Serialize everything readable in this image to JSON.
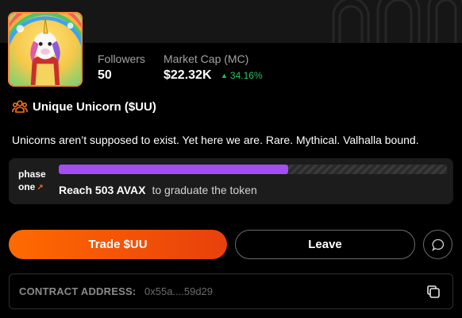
{
  "stats": {
    "followers_label": "Followers",
    "followers_value": "50",
    "market_cap_label": "Market Cap (MC)",
    "market_cap_value": "$22.32K",
    "market_cap_change": "34.16%",
    "change_icon": "triangle-up-icon"
  },
  "token": {
    "name": "Unique Unicorn ($UU)",
    "icon": "users-group-icon",
    "description": "Unicorns aren’t supposed to exist. Yet here we are. Rare. Mythical. Valhalla bound."
  },
  "phase": {
    "label_line1": "phase",
    "label_line2": "one",
    "external_icon": "↗",
    "progress": 0.59,
    "goal_amount": "Reach 503 AVAX",
    "goal_text": "to graduate the token"
  },
  "actions": {
    "trade_label": "Trade $UU",
    "leave_label": "Leave",
    "chat_icon": "chat-bubble-icon"
  },
  "contract": {
    "label": "CONTRACT ADDRESS:",
    "value": "0x55a....59d29",
    "copy_icon": "copy-icon"
  },
  "colors": {
    "accent_orange": "#ff6a00",
    "progress_purple": "#a54df2",
    "positive_green": "#22c55e"
  }
}
